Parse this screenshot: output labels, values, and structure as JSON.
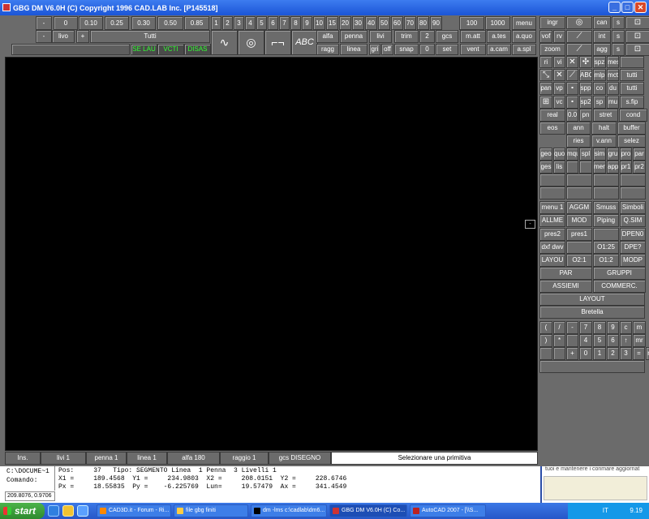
{
  "window": {
    "title": "GBG DM V6.0H (C) Copyright 1996 CAD.LAB Inc.    [P145518]",
    "minimize": "_",
    "maximize": "□",
    "close": "✕"
  },
  "toolbar": {
    "row1": [
      "-",
      "0",
      "0.10",
      "0.25",
      "0.30",
      "0.50",
      "0.85",
      "1",
      "2",
      "3",
      "4",
      "5",
      "6",
      "7",
      "8",
      "9",
      "10",
      "15",
      "20",
      "30",
      "40",
      "50",
      "60",
      "70",
      "80",
      "90",
      "100",
      "1000",
      "menu"
    ],
    "row2": [
      "-",
      "livo",
      "+",
      "Tutti"
    ],
    "row3": [
      "SE LAU",
      "VCTI",
      "DISAS"
    ],
    "icons": [
      "polyline-icon",
      "circle-icon",
      "frame-icon",
      "text-abc-icon"
    ],
    "mid_row2": [
      "alfa",
      "penna",
      "livi",
      "trim",
      "2",
      "gcs",
      "m.att",
      "a.tes",
      "a.quo"
    ],
    "mid_row3": [
      "ragg",
      "linea",
      "gri",
      "off",
      "snap",
      "0",
      "set",
      "vent",
      "a.cam",
      "a.spl"
    ]
  },
  "right_panel": {
    "r1": [
      "ingr",
      "",
      "can",
      "s",
      ""
    ],
    "r2": [
      "vof",
      "rv",
      "",
      "int",
      "s",
      ""
    ],
    "r3": [
      "zoom",
      "",
      "agg",
      "s",
      ""
    ],
    "r4": [
      "ri",
      "vi",
      "",
      "",
      "spz",
      "mes",
      ""
    ],
    "r5": [
      "",
      "",
      "",
      "ABC",
      "mlp",
      "mct",
      "tutti"
    ],
    "r6": [
      "pan",
      "vp",
      "",
      "spp",
      "co",
      "du",
      "tutti"
    ],
    "r7": [
      "",
      "vc",
      "",
      "sp2",
      "sp",
      "mu",
      "s.fip"
    ],
    "r8": [
      "real",
      "0.0",
      "pn",
      "stret",
      "cond"
    ],
    "r9": [
      "eos",
      "ann",
      "halt",
      "buffer"
    ],
    "r10": [
      "ries",
      "v.ann",
      "selez"
    ],
    "r11": [
      "geo",
      "quo",
      "mqu",
      "spl",
      "sim",
      "gru",
      "pro",
      "par"
    ],
    "r12": [
      "ges",
      "lis",
      "",
      "",
      "men",
      "app",
      "pr1",
      "pr2"
    ],
    "r15": [
      "menu 1",
      "AGGM",
      "Smuss",
      "Simboli"
    ],
    "r16": [
      "ALLME",
      "MOD",
      "Piping",
      "Q.SIM"
    ],
    "r17": [
      "pres2",
      "pres1",
      "",
      "DPEN0"
    ],
    "r18": [
      "dxf dwv",
      "",
      "O1:25",
      "DPE?"
    ],
    "r19": [
      "LAYOU",
      "O2:1",
      "O1:2",
      "MODP"
    ],
    "r20": [
      "PAR",
      "GRUPPI"
    ],
    "r21": [
      "ASSIEMI",
      "COMMERC."
    ],
    "r22": [
      "LAYOUT"
    ],
    "r23": [
      "Bretella"
    ],
    "k1": [
      "(",
      "/",
      "-",
      "7",
      "8",
      "9",
      "c",
      "m"
    ],
    "k2": [
      ")",
      "*",
      "",
      "4",
      "5",
      "6",
      "↑",
      "mr"
    ],
    "k3": [
      "",
      "",
      "+",
      "0",
      "1",
      "2",
      "3",
      "=",
      "ngr"
    ]
  },
  "canvas": {
    "marker": "-"
  },
  "status": {
    "ins": "Ins.",
    "livi": "livi 1",
    "penna": "penna 1",
    "linea": "linea 1",
    "alfa": "alfa 180",
    "raggio": "raggio 1",
    "gcs": "gcs DISEGNO",
    "message": "Selezionare una primitiva"
  },
  "info": {
    "path": "C:\\DOCUME~1",
    "comando": "Comando:",
    "coords": "209.8076, 0.9706 ,",
    "line1": "Pos:     37   Tipo: SEGMENTO Linea  1 Penna  3 Livelli 1",
    "line2": "X1 =     189.4568  Y1 =     234.9803  X2 =     208.0151  Y2 =     228.6746",
    "line3": "Px =     18.55835  Py =    -6.225769  Lun=     19.57479  Ax =     341.4549"
  },
  "acad": {
    "text": "tuoi e mantenere i conmare aggiornat"
  },
  "taskbar": {
    "start": "start",
    "items": [
      "CAD3D.it - Forum - Ri...",
      "file gbg finiti",
      "dm -lms c:\\cadlab\\dm6...",
      "GBG DM V6.0H (C) Co...",
      "AutoCAD 2007 - [\\\\S..."
    ],
    "clock": "9.19",
    "lang": "IT"
  },
  "colors": {
    "background": "#6b6b6b",
    "canvas": "#000000",
    "title": "#1b55d6"
  }
}
